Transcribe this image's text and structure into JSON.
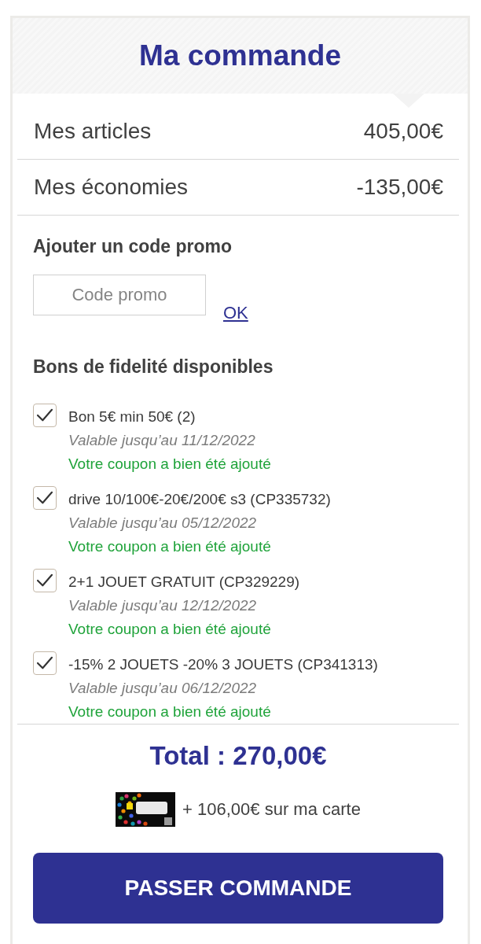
{
  "header": {
    "title": "Ma commande"
  },
  "summary": [
    {
      "label": "Mes articles",
      "value": "405,00€"
    },
    {
      "label": "Mes économies",
      "value": "-135,00€"
    }
  ],
  "promo": {
    "heading": "Ajouter un code promo",
    "field": {
      "placeholder": "Code promo"
    },
    "submit": "OK"
  },
  "vouchers": {
    "heading": "Bons de fidelité disponibles",
    "items": [
      {
        "name": "Bon 5€ min 50€ (2)",
        "validity": "Valable jusqu’au 11/12/2022",
        "message": "Votre coupon a bien été ajouté",
        "checked": true
      },
      {
        "name": "drive 10/100€-20€/200€ s3 (CP335732)",
        "validity": "Valable jusqu’au 05/12/2022",
        "message": "Votre coupon a bien été ajouté",
        "checked": true
      },
      {
        "name": "2+1 JOUET GRATUIT (CP329229)",
        "validity": "Valable jusqu’au 12/12/2022",
        "message": "Votre coupon a bien été ajouté",
        "checked": true
      },
      {
        "name": "-15% 2 JOUETS -20% 3 JOUETS (CP341313)",
        "validity": "Valable jusqu’au 06/12/2022",
        "message": "Votre coupon a bien été ajouté",
        "checked": true
      }
    ]
  },
  "total": "Total : 270,00€",
  "loyalty": {
    "text": "+ 106,00€ sur ma carte"
  },
  "checkout_button": "PASSER COMMANDE"
}
